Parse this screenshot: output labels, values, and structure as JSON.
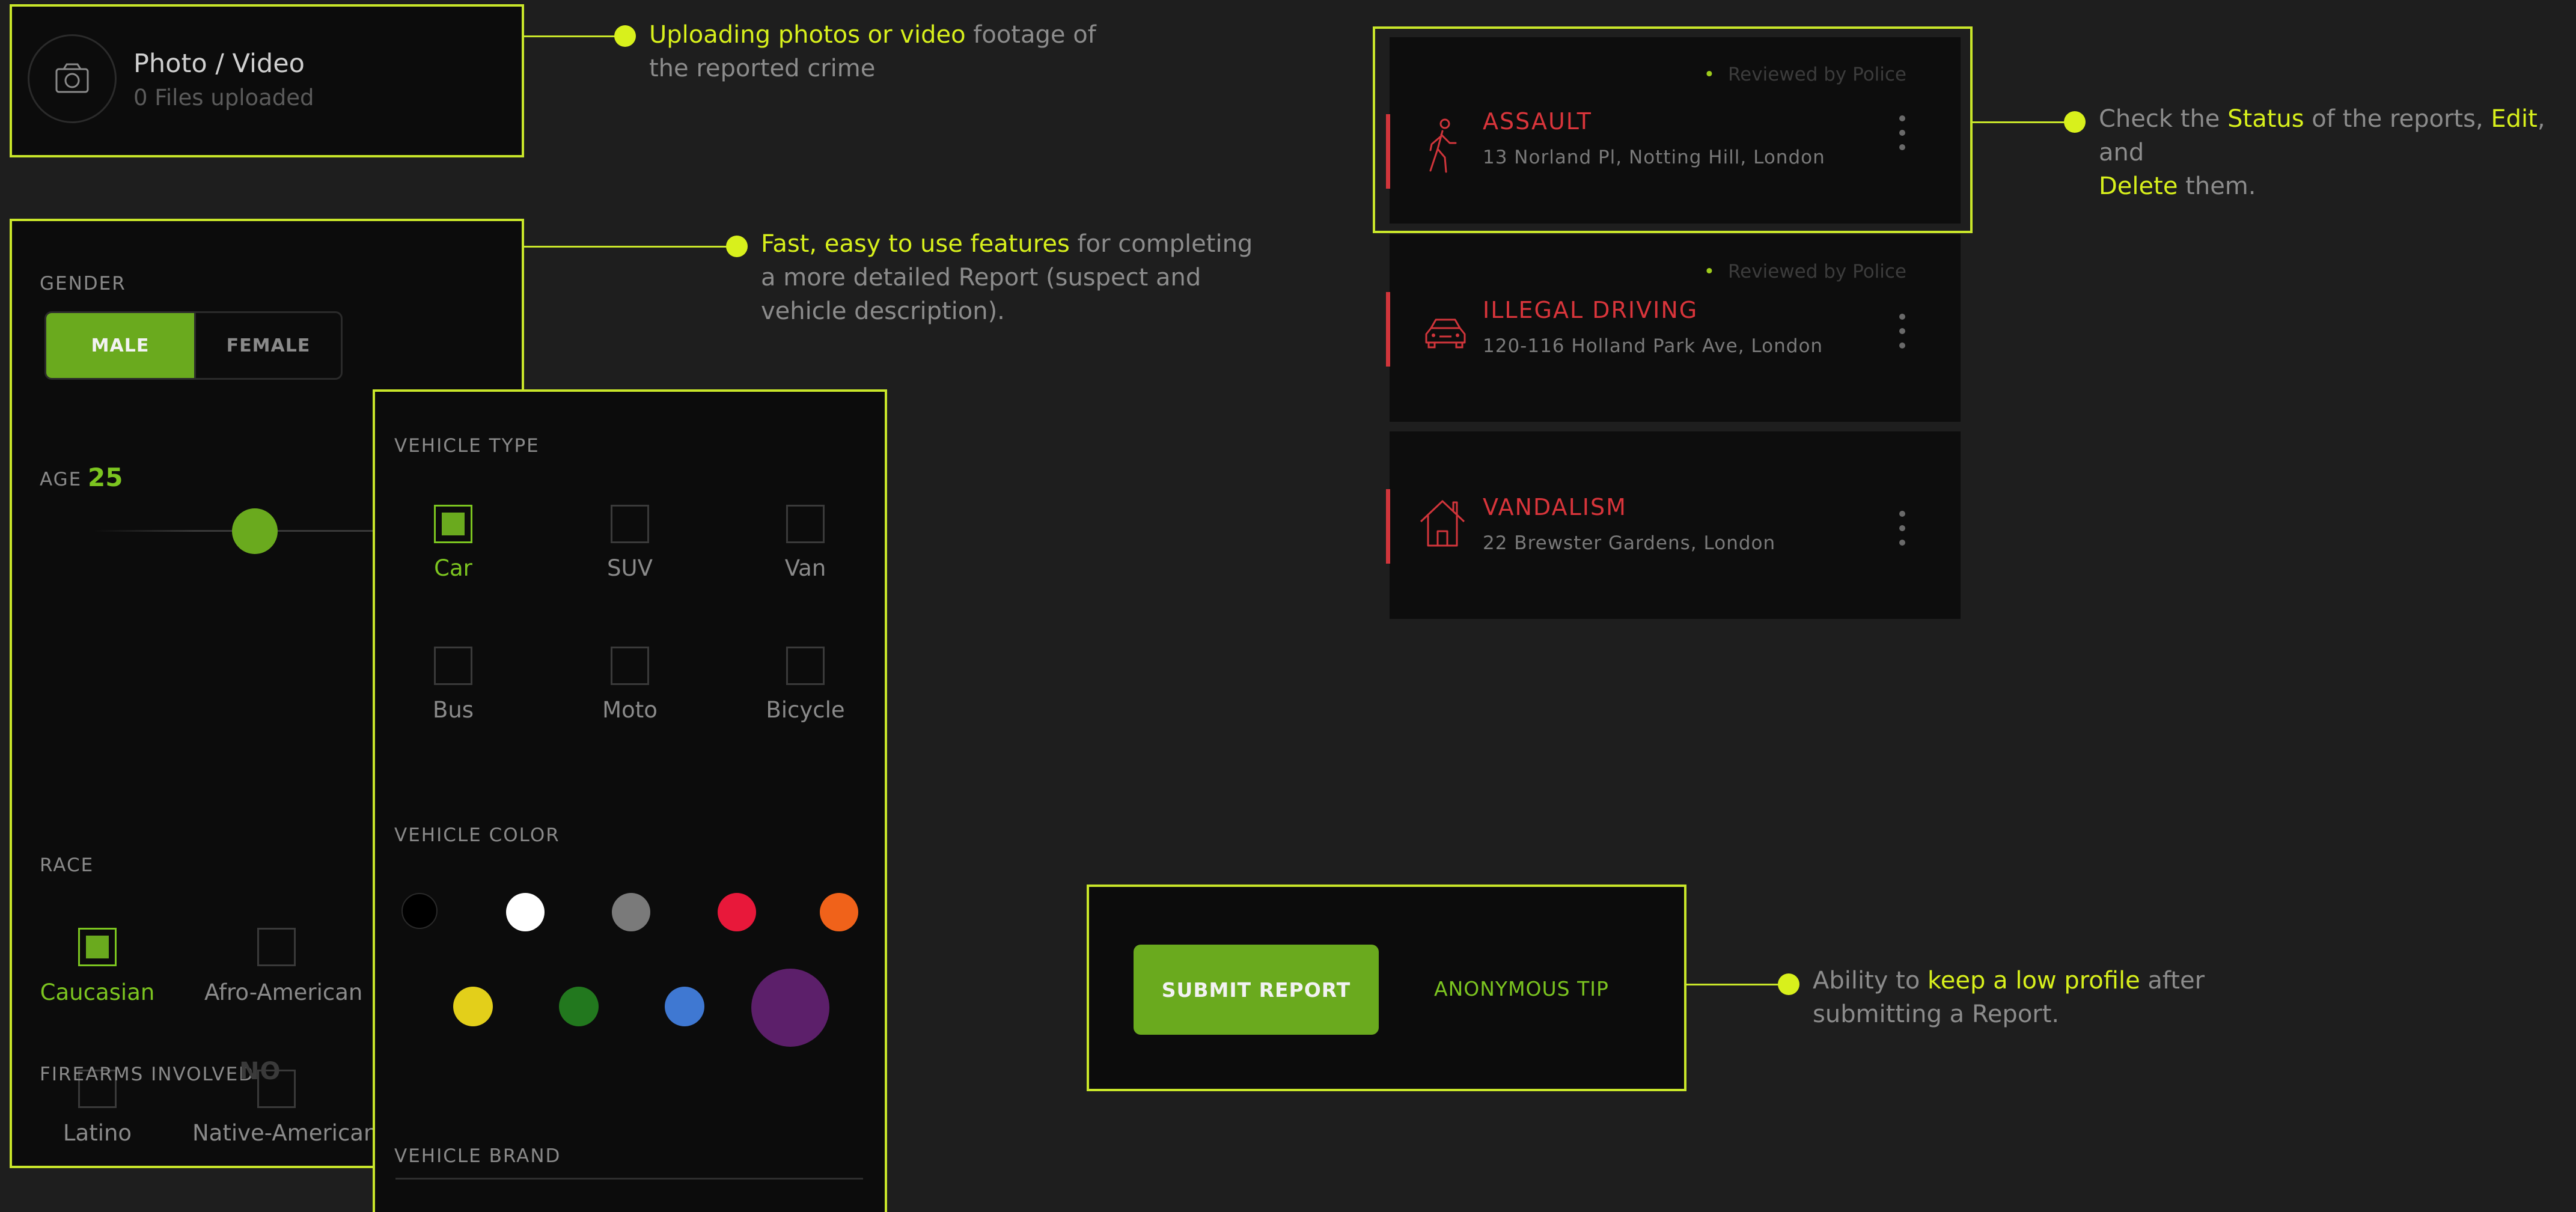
{
  "upload": {
    "title": "Photo / Video",
    "subtitle": "0 Files uploaded",
    "callout_highlight": "Uploading photos or video",
    "callout_rest_1": " footage of",
    "callout_line_2": "the reported crime"
  },
  "suspect": {
    "gender_label": "GENDER",
    "gender_options": [
      "MALE",
      "FEMALE"
    ],
    "gender_selected": "MALE",
    "age_label": "AGE",
    "age_value": "25",
    "race_label": "RACE",
    "race_options": [
      {
        "label": "Caucasian",
        "checked": true
      },
      {
        "label": "Afro-American",
        "checked": false
      },
      {
        "label": "Latino",
        "checked": false
      },
      {
        "label": "Native-American",
        "checked": false
      }
    ],
    "firearms_label": "FIREARMS INVOLVED",
    "firearms_value": "NO",
    "callout_highlight": "Fast, easy to use features",
    "callout_rest_1": " for completing",
    "callout_line_2": "a more detailed Report (suspect and",
    "callout_line_3": "vehicle description)."
  },
  "vehicle": {
    "type_label": "VEHICLE TYPE",
    "types": [
      {
        "label": "Car",
        "checked": true
      },
      {
        "label": "SUV",
        "checked": false
      },
      {
        "label": "Van",
        "checked": false
      },
      {
        "label": "Bus",
        "checked": false
      },
      {
        "label": "Moto",
        "checked": false
      },
      {
        "label": "Bicycle",
        "checked": false
      }
    ],
    "color_label": "VEHICLE COLOR",
    "colors": [
      "#000000",
      "#ffffff",
      "#7a7a7a",
      "#e8183a",
      "#f0621a",
      "#e3cf1a",
      "#22781e",
      "#3f78d2",
      "#5c1f6a"
    ],
    "brand_label": "VEHICLE BRAND"
  },
  "reports": {
    "cards": [
      {
        "title": "ASSAULT",
        "address": "13 Norland Pl, Notting Hill, London",
        "status": "Reviewed by Police",
        "icon": "walking-person-icon"
      },
      {
        "title": "ILLEGAL DRIVING",
        "address": "120-116 Holland Park Ave, London",
        "status": "Reviewed by Police",
        "icon": "car-icon"
      },
      {
        "title": "VANDALISM",
        "address": "22 Brewster Gardens, London",
        "status": "",
        "icon": "house-icon"
      }
    ],
    "callout_pre": "Check the ",
    "callout_status": "Status",
    "callout_mid": " of the reports, ",
    "callout_edit": "Edit",
    "callout_and": ", and",
    "callout_delete": "Delete",
    "callout_end": " them."
  },
  "submit": {
    "submit_label": "SUBMIT REPORT",
    "anon_label": "ANONYMOUS TIP",
    "callout_pre": "Ability to ",
    "callout_highlight": "keep a low profile",
    "callout_rest_1": " after",
    "callout_line_2": "submitting a Report."
  },
  "colors": {
    "accent": "#c9e62a",
    "green": "#6aaa1e",
    "danger": "#d9353b",
    "background": "#1e1e1e"
  }
}
